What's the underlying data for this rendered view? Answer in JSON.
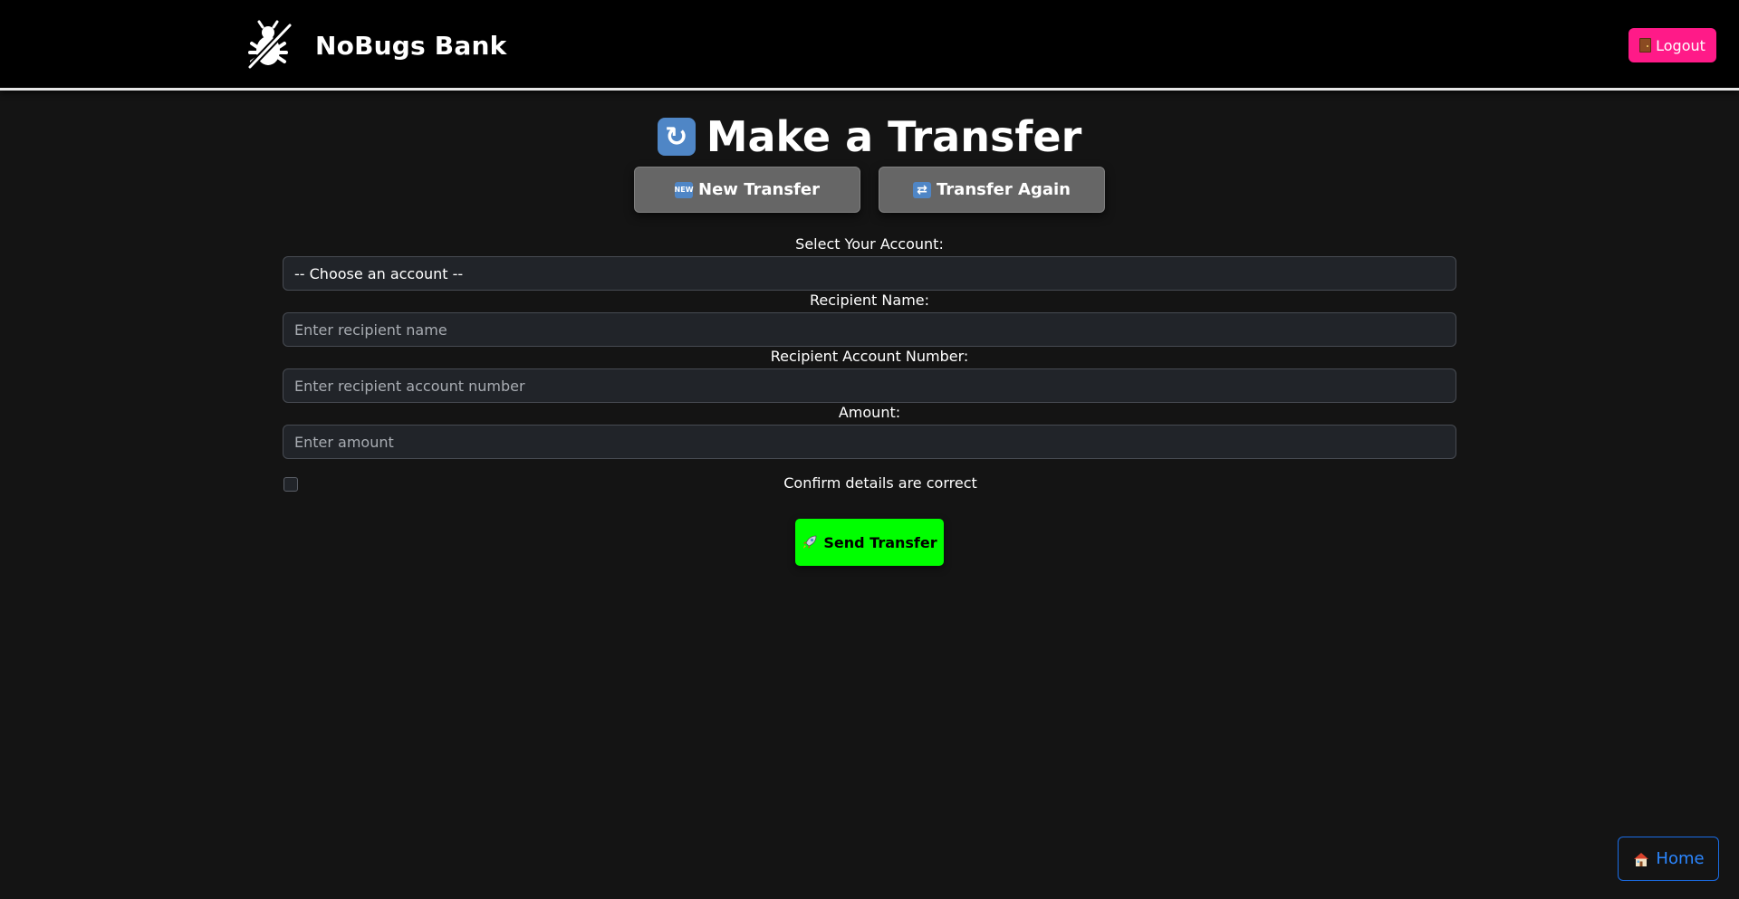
{
  "header": {
    "brand_name": "NoBugs Bank",
    "logo_icon": "bug-crossed-icon",
    "logout_label": "Logout",
    "logout_icon": "door-icon"
  },
  "page": {
    "title": "Make a Transfer",
    "title_icon": "refresh-arrows-icon"
  },
  "tabs": [
    {
      "label": "New Transfer",
      "icon": "new-badge-icon",
      "icon_text": "NEW"
    },
    {
      "label": "Transfer Again",
      "icon": "repeat-icon"
    }
  ],
  "form": {
    "account_label": "Select Your Account:",
    "account_selected": "-- Choose an account --",
    "recipient_name_label": "Recipient Name:",
    "recipient_name_placeholder": "Enter recipient name",
    "recipient_account_label": "Recipient Account Number:",
    "recipient_account_placeholder": "Enter recipient account number",
    "amount_label": "Amount:",
    "amount_placeholder": "Enter amount",
    "confirm_label": "Confirm details are correct",
    "confirm_checked": false,
    "send_label": "Send Transfer",
    "send_icon": "rocket-icon"
  },
  "footer": {
    "home_label": "Home",
    "home_icon": "house-icon"
  },
  "colors": {
    "background": "#141414",
    "header": "#000000",
    "logout": "#ff1a88",
    "send": "#00ff00",
    "home": "#2b86ff",
    "tab": "#666666"
  }
}
